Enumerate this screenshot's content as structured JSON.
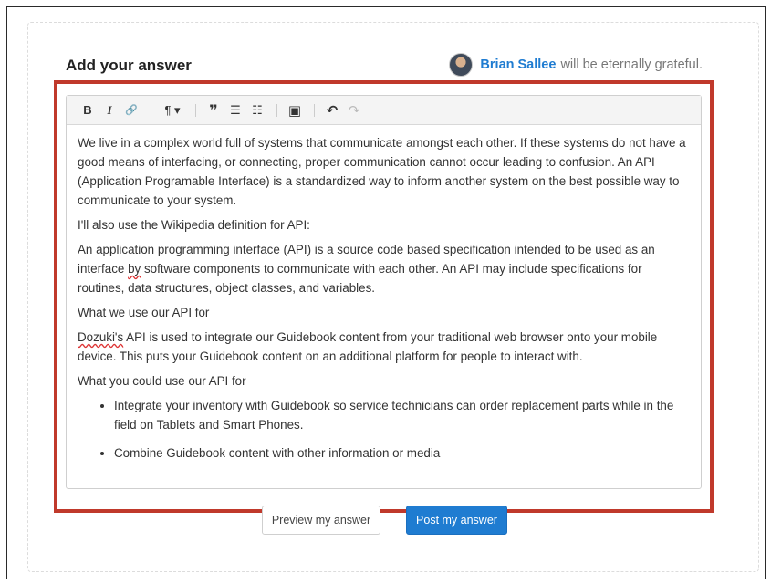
{
  "header": {
    "title": "Add your answer",
    "grateful_name": "Brian Sallee",
    "grateful_text": "will be eternally grateful."
  },
  "toolbar": {
    "buttons": [
      {
        "icon": "bold-icon",
        "glyph": "B"
      },
      {
        "icon": "italic-icon",
        "glyph": "I"
      },
      {
        "icon": "link-icon",
        "glyph": "🔗"
      },
      {
        "icon": "paragraph-icon",
        "glyph": "¶ ▾"
      },
      {
        "icon": "quote-icon",
        "glyph": "❞"
      },
      {
        "icon": "bulleted-list-icon",
        "glyph": "☰"
      },
      {
        "icon": "numbered-list-icon",
        "glyph": "☷"
      },
      {
        "icon": "image-icon",
        "glyph": "▣"
      },
      {
        "icon": "undo-icon",
        "glyph": "↶"
      },
      {
        "icon": "redo-icon",
        "glyph": "↷"
      }
    ]
  },
  "content": {
    "p1": "We live in a complex world full of systems that communicate amongst each other. If these systems do not have a good means of interfacing, or connecting, proper communication cannot occur leading to confusion. An API (Application Programable Interface) is a standardized way to inform another system on the best possible way to communicate to your system.",
    "p2": "I'll also use the Wikipedia definition for API:",
    "p3a": "An application programming interface (API) is a source code based specification intended to be used as an interface ",
    "p3b": "by",
    "p3c": " software components to communicate with each other. An API may include specifications for routines, data structures, object classes, and variables.",
    "p4": "What we use our API for",
    "p5a": "Dozuki's",
    "p5b": " API is used to integrate our Guidebook content from your traditional web browser onto your mobile device. This puts your Guidebook content on an additional platform for people to interact with.",
    "p6": "What you could use our API for",
    "list": [
      "Integrate your inventory with Guidebook so service technicians can order replacement parts while in the field on Tablets and Smart Phones.",
      "Combine Guidebook content with other information or media"
    ]
  },
  "actions": {
    "preview_label": "Preview my answer",
    "post_label": "Post my answer"
  },
  "colors": {
    "accent": "#1f7cd1",
    "highlight": "#c0392b"
  }
}
